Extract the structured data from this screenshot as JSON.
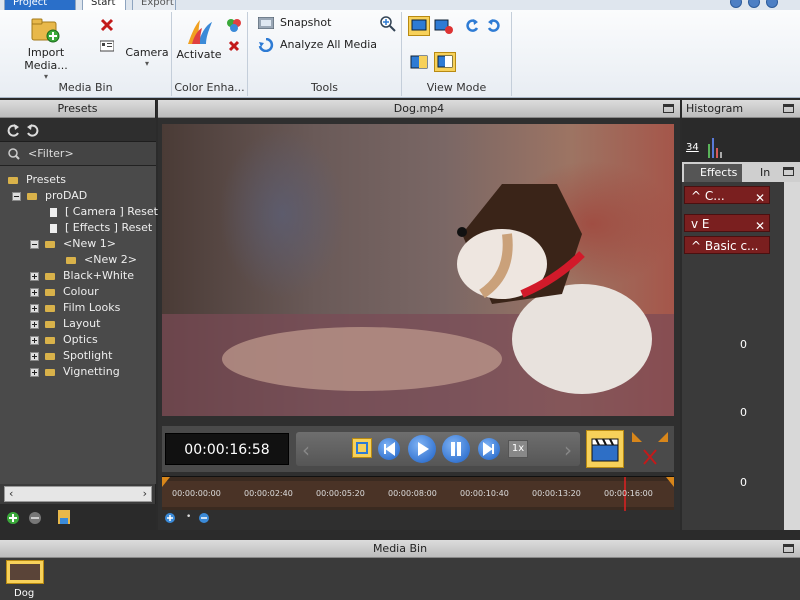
{
  "tabs": {
    "project": "Project",
    "start": "Start",
    "export": "Export"
  },
  "ribbon": {
    "groups": {
      "media_bin": "Media Bin",
      "color_enhance": "Color Enha...",
      "tools": "Tools",
      "view_mode": "View Mode"
    },
    "import_media": "Import Media...",
    "camera": "Camera",
    "activate": "Activate",
    "snapshot": "Snapshot",
    "analyze_all_media": "Analyze All Media"
  },
  "presets": {
    "title": "Presets",
    "filter_placeholder": "<Filter>",
    "tree": {
      "root": "Presets",
      "prodad": "proDAD",
      "camera_reset": "[ Camera ]  Reset",
      "effects_reset": "[ Effects ]  Reset",
      "new1": "<New   1>",
      "new2": "<New   2>",
      "black_white": "Black+White",
      "colour": "Colour",
      "film_looks": "Film Looks",
      "layout": "Layout",
      "optics": "Optics",
      "spotlight": "Spotlight",
      "vignetting": "Vignetting"
    }
  },
  "video": {
    "title": "Dog.mp4",
    "timecode": "00:00:16:58",
    "speed": "1x",
    "timeline_ticks": [
      "00:00:00:00",
      "00:00:02:40",
      "00:00:05:20",
      "00:00:08:00",
      "00:00:10:40",
      "00:00:13:20",
      "00:00:16:00"
    ]
  },
  "histogram": {
    "title": "Histogram",
    "value": "34"
  },
  "effects": {
    "tab_effects": "Effects",
    "tab_info": "In",
    "items": [
      "C...",
      "E",
      "Basic c..."
    ],
    "values": [
      "0",
      "0",
      "0"
    ]
  },
  "media_bin": {
    "title": "Media Bin",
    "clip": "Dog"
  },
  "colors": {
    "accent": "#2a6fc9",
    "effect_header": "#7a1f1f",
    "panel_bg": "#3a3a3a"
  }
}
